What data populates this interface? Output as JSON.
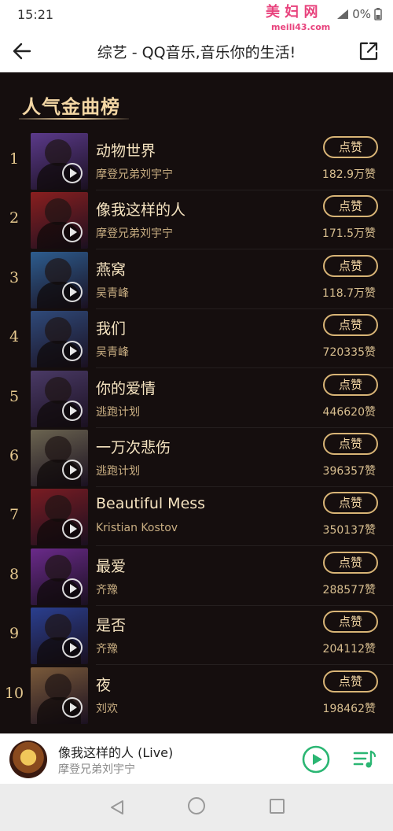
{
  "status_bar": {
    "time": "15:21",
    "battery_text": "0%"
  },
  "watermark": {
    "text": "美 妇 网",
    "url": "meili43.com"
  },
  "header": {
    "title": "综艺 - QQ音乐,音乐你的生活!"
  },
  "section": {
    "title": "人气金曲榜"
  },
  "songs": [
    {
      "rank": "1",
      "title": "动物世界",
      "artist": "摩登兄弟刘宇宁",
      "like_label": "点赞",
      "likes": "182.9万赞",
      "thumb_color": "#5b3a8a"
    },
    {
      "rank": "2",
      "title": "像我这样的人",
      "artist": "摩登兄弟刘宇宁",
      "like_label": "点赞",
      "likes": "171.5万赞",
      "thumb_color": "#8a1f1f"
    },
    {
      "rank": "3",
      "title": "燕窝",
      "artist": "吴青峰",
      "like_label": "点赞",
      "likes": "118.7万赞",
      "thumb_color": "#2d5d8f"
    },
    {
      "rank": "4",
      "title": "我们",
      "artist": "吴青峰",
      "like_label": "点赞",
      "likes": "720335赞",
      "thumb_color": "#2f4a7a"
    },
    {
      "rank": "5",
      "title": "你的爱情",
      "artist": "逃跑计划",
      "like_label": "点赞",
      "likes": "446620赞",
      "thumb_color": "#4a3a66"
    },
    {
      "rank": "6",
      "title": "一万次悲伤",
      "artist": "逃跑计划",
      "like_label": "点赞",
      "likes": "396357赞",
      "thumb_color": "#6b6450"
    },
    {
      "rank": "7",
      "title": "Beautiful Mess",
      "artist": "Kristian Kostov",
      "like_label": "点赞",
      "likes": "350137赞",
      "thumb_color": "#7a1c22"
    },
    {
      "rank": "8",
      "title": "最爱",
      "artist": "齐豫",
      "like_label": "点赞",
      "likes": "288577赞",
      "thumb_color": "#6a2a8a"
    },
    {
      "rank": "9",
      "title": "是否",
      "artist": "齐豫",
      "like_label": "点赞",
      "likes": "204112赞",
      "thumb_color": "#2a3f8f"
    },
    {
      "rank": "10",
      "title": "夜",
      "artist": "刘欢",
      "like_label": "点赞",
      "likes": "198462赞",
      "thumb_color": "#7a5a3a"
    }
  ],
  "now_playing": {
    "title": "像我这样的人 (Live)",
    "artist": "摩登兄弟刘宇宁"
  },
  "colors": {
    "background": "#150e0e",
    "gold": "#f3d6a4",
    "accent_green": "#2bb673"
  }
}
